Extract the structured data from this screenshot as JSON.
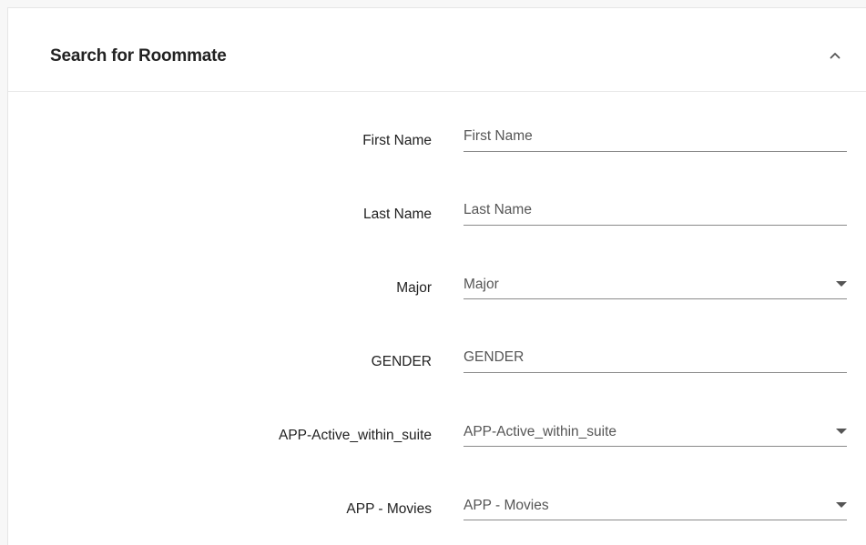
{
  "panel": {
    "title": "Search for Roommate",
    "collapse_icon": "chevron-up-icon"
  },
  "form": {
    "fields": [
      {
        "label": "First Name",
        "type": "text",
        "placeholder": "First Name",
        "value": ""
      },
      {
        "label": "Last Name",
        "type": "text",
        "placeholder": "Last Name",
        "value": ""
      },
      {
        "label": "Major",
        "type": "select",
        "selected": "Major",
        "icon": "dropdown-arrow-icon"
      },
      {
        "label": "GENDER",
        "type": "text",
        "placeholder": "GENDER",
        "value": ""
      },
      {
        "label": "APP-Active_within_suite",
        "type": "select",
        "selected": "APP-Active_within_suite",
        "icon": "dropdown-arrow-icon"
      },
      {
        "label": "APP - Movies",
        "type": "select",
        "selected": "APP - Movies",
        "icon": "dropdown-arrow-icon"
      }
    ]
  }
}
